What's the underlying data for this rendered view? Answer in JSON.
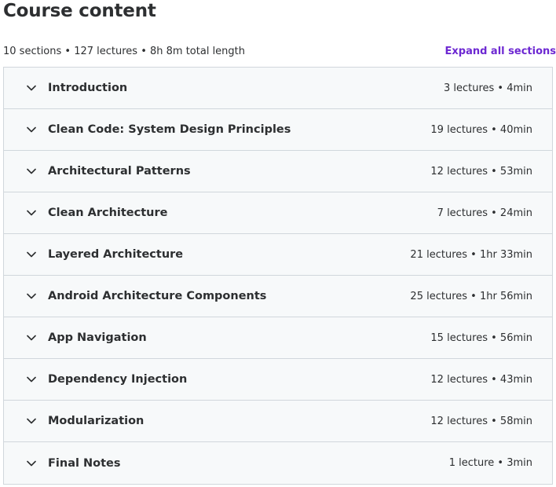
{
  "header": {
    "title": "Course content",
    "summary": "10 sections • 127 lectures • 8h 8m total length",
    "expand_all_label": "Expand all sections"
  },
  "colors": {
    "link": "#6d28d2",
    "text": "#2d2f31",
    "row_bg": "#f7f9fa",
    "border": "#d1d7dc"
  },
  "sections": [
    {
      "title": "Introduction",
      "meta": "3 lectures • 4min",
      "icon": "chevron-down-icon"
    },
    {
      "title": "Clean Code: System Design Principles",
      "meta": "19 lectures • 40min",
      "icon": "chevron-down-icon"
    },
    {
      "title": "Architectural Patterns",
      "meta": "12 lectures • 53min",
      "icon": "chevron-down-icon"
    },
    {
      "title": "Clean Architecture",
      "meta": "7 lectures • 24min",
      "icon": "chevron-down-icon"
    },
    {
      "title": "Layered Architecture",
      "meta": "21 lectures • 1hr 33min",
      "icon": "chevron-down-icon"
    },
    {
      "title": "Android Architecture Components",
      "meta": "25 lectures • 1hr 56min",
      "icon": "chevron-down-icon"
    },
    {
      "title": "App Navigation",
      "meta": "15 lectures • 56min",
      "icon": "chevron-down-icon"
    },
    {
      "title": "Dependency Injection",
      "meta": "12 lectures • 43min",
      "icon": "chevron-down-icon"
    },
    {
      "title": "Modularization",
      "meta": "12 lectures • 58min",
      "icon": "chevron-down-icon"
    },
    {
      "title": "Final Notes",
      "meta": "1 lecture • 3min",
      "icon": "chevron-down-icon"
    }
  ]
}
